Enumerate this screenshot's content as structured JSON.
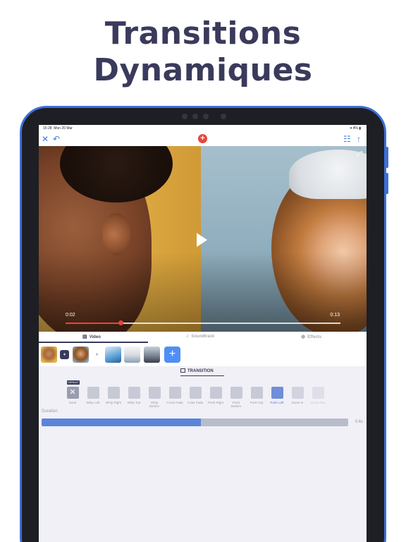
{
  "headline": {
    "line1": "Transitions",
    "line2": "Dynamiques"
  },
  "status": {
    "time": "15:28",
    "date": "Mon 20 Mar",
    "right": "▾ 4% ▮"
  },
  "toolbar": {
    "close": "✕",
    "undo": "↶",
    "add": "+",
    "adjust": "☷",
    "share": "↑"
  },
  "video": {
    "current_time": "0:02",
    "total_time": "0:13",
    "progress": 0.2,
    "expand_icon": "⤢"
  },
  "tabs": [
    {
      "label": "Video",
      "active": true
    },
    {
      "label": "Soundtrack",
      "active": false
    },
    {
      "label": "Effects",
      "active": false
    }
  ],
  "clips": {
    "add_label": "+"
  },
  "transition_panel": {
    "title": "TRANSITION",
    "default_badge": "DEFAULT",
    "items": [
      {
        "label": "None"
      },
      {
        "label": "Whip Left"
      },
      {
        "label": "Whip Right"
      },
      {
        "label": "Whip Top"
      },
      {
        "label": "Whip Bottom"
      },
      {
        "label": "Cross Fade"
      },
      {
        "label": "Color Fade"
      },
      {
        "label": "Push Right"
      },
      {
        "label": "Push Bottom"
      },
      {
        "label": "Push Top"
      },
      {
        "label": "Push Left"
      },
      {
        "label": "Zoom In"
      },
      {
        "label": "Zoom Out"
      }
    ],
    "selected_label": "Push Left"
  },
  "duration": {
    "label": "Duration",
    "value": "0.6s",
    "fraction": 0.52
  },
  "colors": {
    "accent": "#3b7be0",
    "record": "#e8463c",
    "headline": "#3a3a5c",
    "frame": "#3b6fd6"
  }
}
